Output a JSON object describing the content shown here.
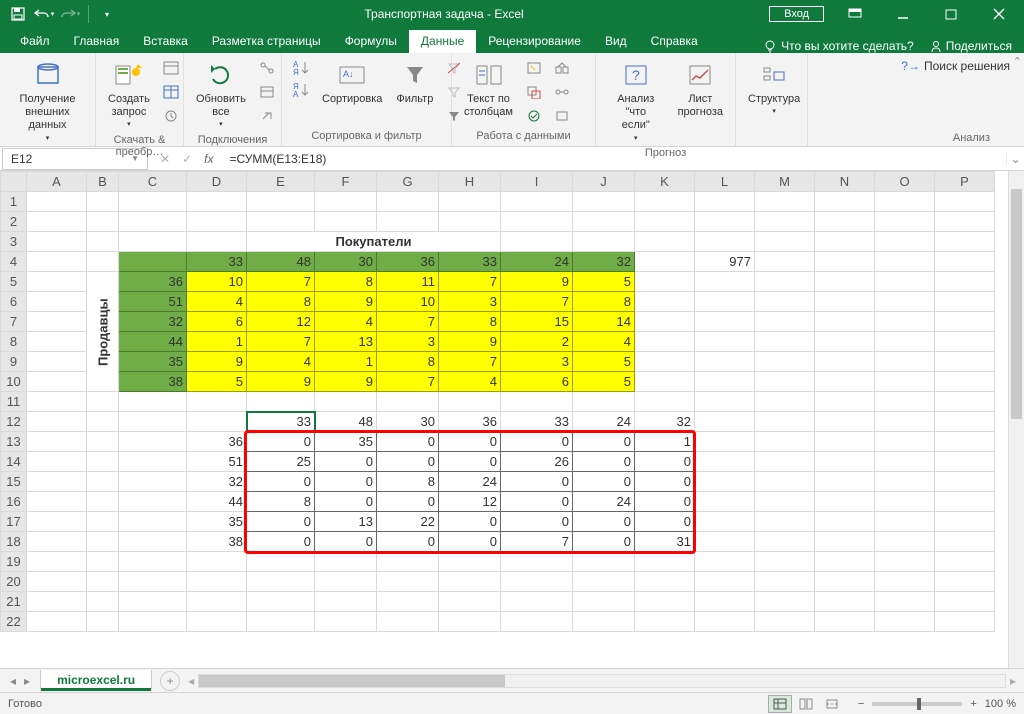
{
  "title": "Транспортная задача  -  Excel",
  "login": "Вход",
  "menu": {
    "file": "Файл",
    "home": "Главная",
    "insert": "Вставка",
    "layout": "Разметка страницы",
    "formulas": "Формулы",
    "data": "Данные",
    "review": "Рецензирование",
    "view": "Вид",
    "help": "Справка",
    "tell": "Что вы хотите сделать?",
    "share": "Поделиться"
  },
  "ribbon": {
    "get_ext": {
      "label": "Получение\nвнешних данных"
    },
    "query": {
      "btn": "Создать\nзапрос",
      "group": "Скачать & преобр…"
    },
    "conn": {
      "btn": "Обновить\nвсе",
      "group": "Подключения"
    },
    "sort": {
      "sort": "Сортировка",
      "filter": "Фильтр",
      "group": "Сортировка и фильтр"
    },
    "tools": {
      "ttc": "Текст по\nстолбцам",
      "group": "Работа с данными"
    },
    "forecast": {
      "what": "Анализ \"что\nесли\"",
      "sheet": "Лист\nпрогноза",
      "group": "Прогноз"
    },
    "outline": {
      "btn": "Структура",
      "group": ""
    },
    "solver": "Поиск решения",
    "analysis_group": "Анализ"
  },
  "name_box": "E12",
  "formula": "=СУММ(E13:E18)",
  "cols": [
    "A",
    "B",
    "C",
    "D",
    "E",
    "F",
    "G",
    "H",
    "I",
    "J",
    "K",
    "L",
    "M",
    "N",
    "O",
    "P"
  ],
  "sheet": {
    "buyers_label": "Покупатели",
    "sellers_label": "Продавцы",
    "col_sums": [
      33,
      48,
      30,
      36,
      33,
      24,
      32
    ],
    "row_sums": [
      36,
      51,
      32,
      44,
      35,
      38
    ],
    "cost": [
      [
        10,
        7,
        8,
        11,
        7,
        9,
        5
      ],
      [
        4,
        8,
        9,
        10,
        3,
        7,
        8
      ],
      [
        6,
        12,
        4,
        7,
        8,
        15,
        14
      ],
      [
        1,
        7,
        13,
        3,
        9,
        2,
        4
      ],
      [
        9,
        4,
        1,
        8,
        7,
        3,
        5
      ],
      [
        5,
        9,
        9,
        7,
        4,
        6,
        5
      ]
    ],
    "alloc_cols": [
      33,
      48,
      30,
      36,
      33,
      24,
      32
    ],
    "alloc_rows": [
      36,
      51,
      32,
      44,
      35,
      38
    ],
    "alloc": [
      [
        0,
        35,
        0,
        0,
        0,
        0,
        1
      ],
      [
        25,
        0,
        0,
        0,
        26,
        0,
        0
      ],
      [
        0,
        0,
        8,
        24,
        0,
        0,
        0
      ],
      [
        8,
        0,
        0,
        12,
        0,
        24,
        0
      ],
      [
        0,
        13,
        22,
        0,
        0,
        0,
        0
      ],
      [
        0,
        0,
        0,
        0,
        7,
        0,
        31
      ]
    ],
    "total": 977
  },
  "sheet_tab": "microexcel.ru",
  "status": "Готово",
  "zoom": "100 %"
}
